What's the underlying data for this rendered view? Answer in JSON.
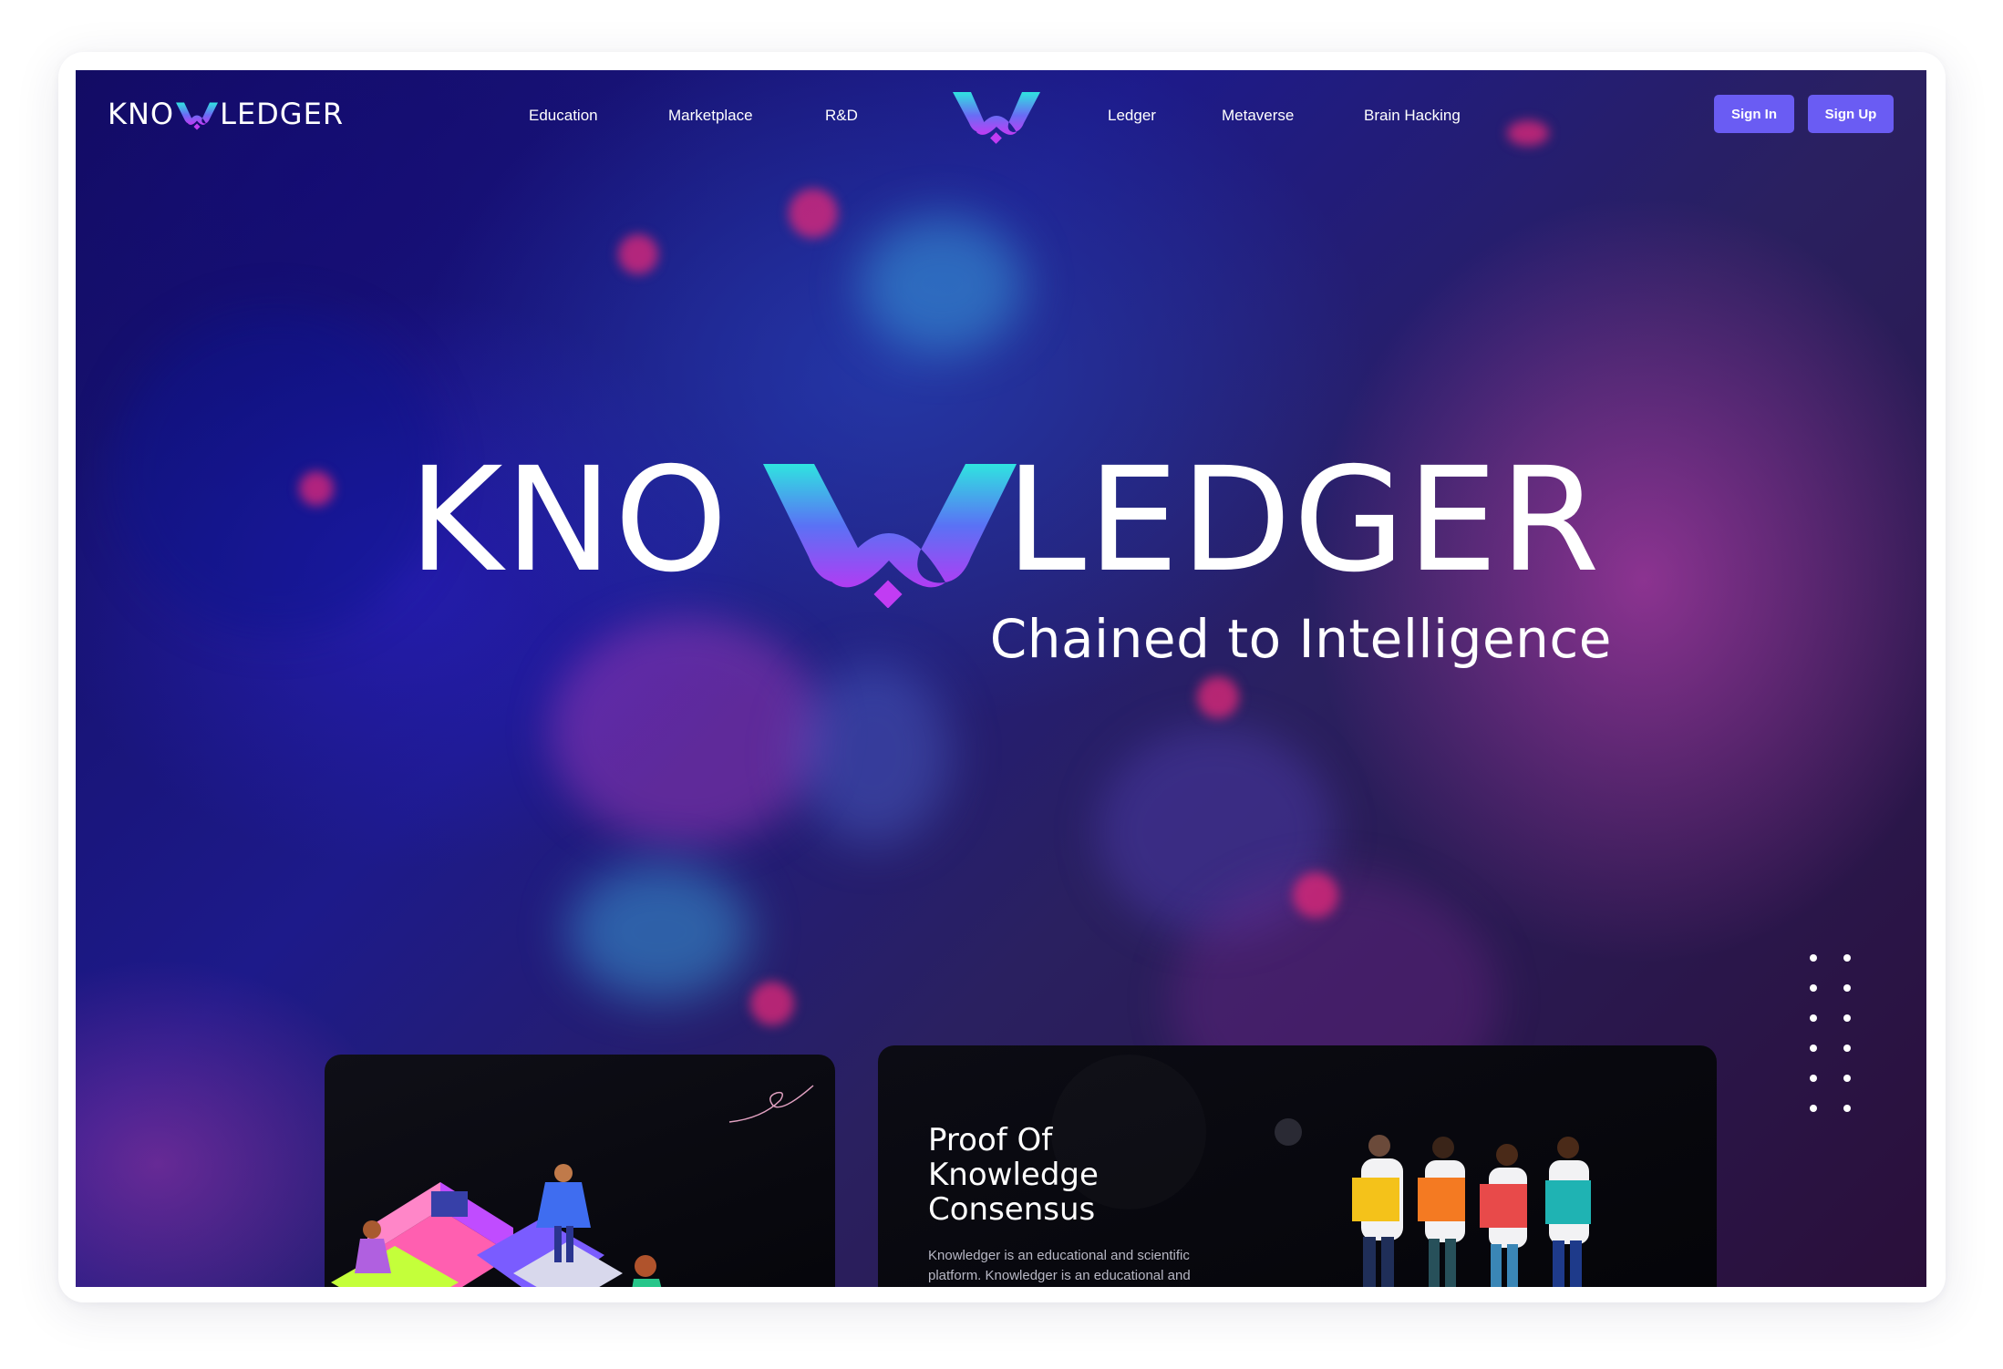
{
  "header": {
    "logo_text_left": "KNO",
    "logo_text_right": "LEDGER",
    "nav_left": [
      "Education",
      "Marketplace",
      "R&D"
    ],
    "nav_right": [
      "Ledger",
      "Metaverse",
      "Brain Hacking"
    ],
    "sign_in": "Sign In",
    "sign_up": "Sign Up"
  },
  "hero": {
    "title_left": "KNO",
    "title_right": "LEDGER",
    "tagline": "Chained to Intelligence"
  },
  "cards": {
    "right": {
      "title": "Proof Of Knowledge Consensus",
      "description": "Knowledger is an educational and scientific platform. Knowledger is an educational and"
    }
  },
  "icons": [
    "knowledger-logo-icon",
    "dots-menu-icon",
    "team-puzzle-illustration",
    "puzzle-building-illustration"
  ],
  "colors": {
    "accent_button": "#6a5cf3",
    "logo_cyan": "#2fe4e0",
    "logo_purple": "#a23df0",
    "logo_magenta": "#c13cf3"
  }
}
